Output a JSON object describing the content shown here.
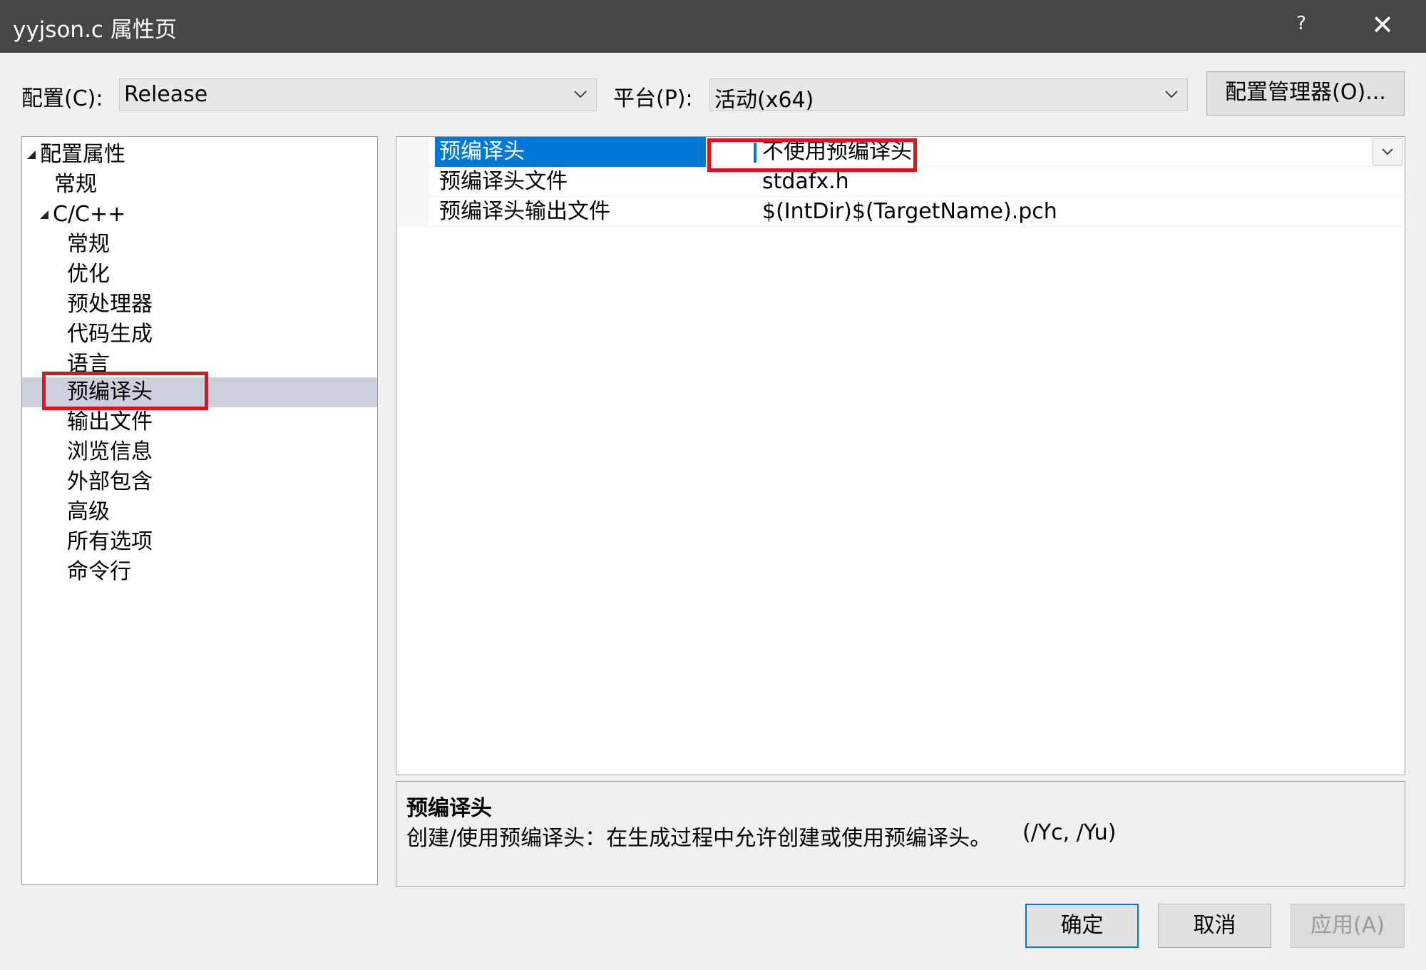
{
  "window": {
    "title": "yyjson.c 属性页",
    "help_label": "?",
    "close_label": "✕"
  },
  "toolbar": {
    "config_label": "配置(C):",
    "config_value": "Release",
    "platform_label": "平台(P):",
    "platform_value": "活动(x64)",
    "config_manager_label": "配置管理器(O)..."
  },
  "tree": {
    "root": "配置属性",
    "general": "常规",
    "cpp": "C/C++",
    "items": [
      "常规",
      "优化",
      "预处理器",
      "代码生成",
      "语言",
      "预编译头",
      "输出文件",
      "浏览信息",
      "外部包含",
      "高级",
      "所有选项",
      "命令行"
    ],
    "selected": "预编译头"
  },
  "properties": [
    {
      "name": "预编译头",
      "value": "不使用预编译头"
    },
    {
      "name": "预编译头文件",
      "value": "stdafx.h"
    },
    {
      "name": "预编译头输出文件",
      "value": "$(IntDir)$(TargetName).pch"
    }
  ],
  "description": {
    "title": "预编译头",
    "text": "创建/使用预编译头：在生成过程中允许创建或使用预编译头。",
    "flags": "(/Yc, /Yu)"
  },
  "buttons": {
    "ok": "确定",
    "cancel": "取消",
    "apply": "应用(A)"
  },
  "colors": {
    "titlebar": "#464646",
    "selection": "#0078d7",
    "tree_selection": "#cdd0dc",
    "highlight": "#e0141e"
  }
}
